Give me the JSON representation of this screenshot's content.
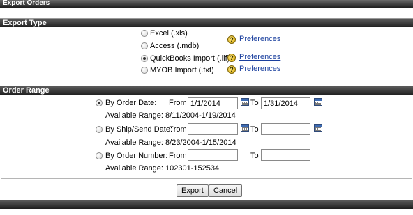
{
  "window": {
    "title": "Export Orders"
  },
  "export_type": {
    "heading": "Export Type",
    "options": [
      {
        "label": "Excel (.xls)",
        "selected": false,
        "preferences": "Preferences"
      },
      {
        "label": "Access (.mdb)",
        "selected": false,
        "preferences": ""
      },
      {
        "label": "QuickBooks Import (.iif)",
        "selected": true,
        "preferences": "Preferences"
      },
      {
        "label": "MYOB Import (.txt)",
        "selected": false,
        "preferences": "Preferences"
      }
    ]
  },
  "order_range": {
    "heading": "Order Range",
    "from_label": "From",
    "to_label": "To",
    "rows": [
      {
        "label": "By Order Date:",
        "selected": true,
        "from": "1/1/2014",
        "to": "1/31/2014",
        "available": "Available Range: 8/11/2004-1/19/2014"
      },
      {
        "label": "By Ship/Send Date:",
        "selected": false,
        "from": "",
        "to": "",
        "available": "Available Range: 8/23/2004-1/15/2014"
      },
      {
        "label": "By Order Number:",
        "selected": false,
        "from": "",
        "to": "",
        "available": "Available Range: 102301-152534"
      }
    ]
  },
  "actions": {
    "export": "Export",
    "cancel": "Cancel"
  },
  "icons": {
    "help": "help-question-icon",
    "calendar": "calendar-icon"
  },
  "colors": {
    "header_bar": "#2a2a2a",
    "link": "#1a3f9e",
    "help_icon": "#e8c000"
  }
}
